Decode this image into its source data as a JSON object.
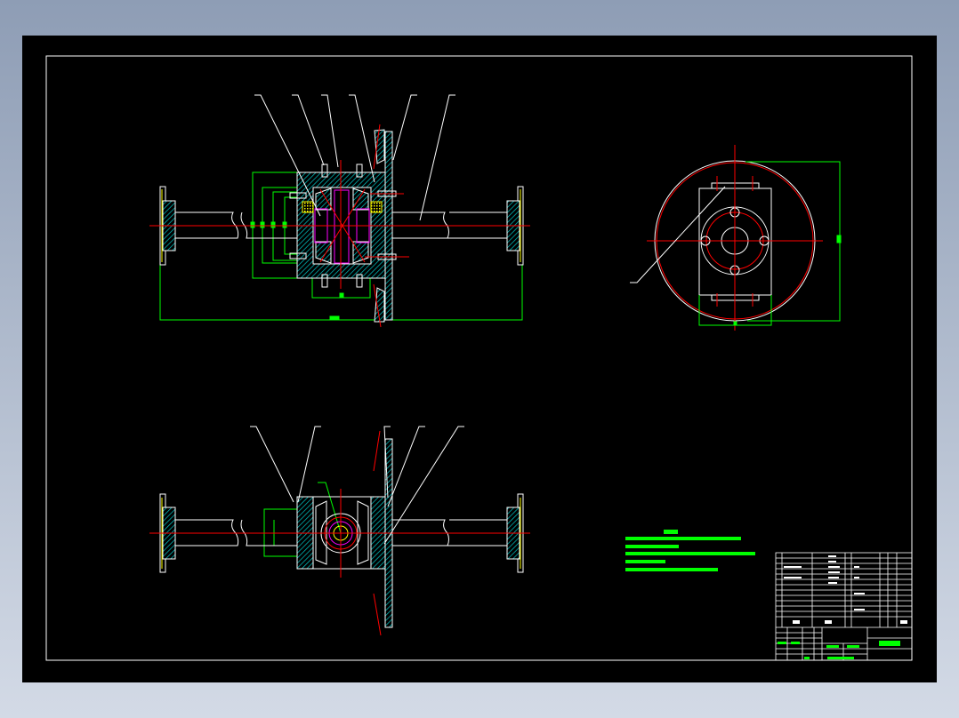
{
  "drawing": {
    "colors": {
      "sheet": "#000000",
      "outline": "#ffffff",
      "centerline": "#ff0000",
      "dimension": "#00ff00",
      "hatch": "#00c8c8",
      "highlight": "#ff00ff",
      "bearing": "#ffff00",
      "viewport_bg": "#8e9db5"
    }
  }
}
